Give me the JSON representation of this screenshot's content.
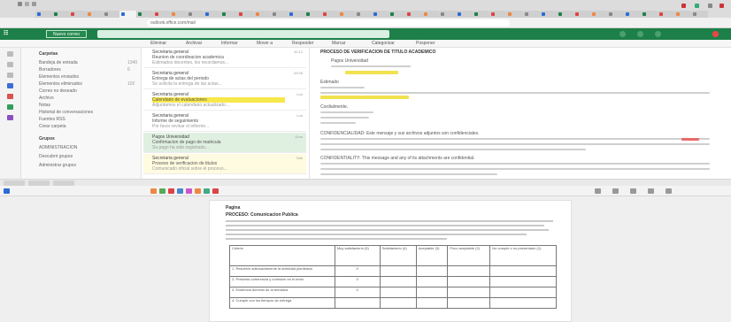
{
  "browser": {
    "url": "outlook.office.com/mail",
    "tabs": [
      "",
      "",
      "",
      "",
      "",
      "",
      "",
      "",
      "",
      "",
      "",
      "",
      "",
      "",
      "",
      "",
      "",
      "",
      "",
      "",
      "",
      "",
      "",
      "",
      "",
      "",
      "",
      "",
      "",
      "",
      "",
      "",
      "",
      "",
      "",
      "",
      "",
      "",
      "",
      ""
    ]
  },
  "app": {
    "new_mail": "Nuevo correo",
    "search_placeholder": "Buscar"
  },
  "ribbon": [
    "Eliminar",
    "Archivar",
    "Informar",
    "Mover a",
    "Responder",
    "Marcar",
    "Categorizar",
    "Posponer"
  ],
  "folders": {
    "header": "Carpetas",
    "items": [
      {
        "label": "Bandeja de entrada",
        "count": "1340"
      },
      {
        "label": "Borradores",
        "count": "6"
      },
      {
        "label": "Elementos enviados",
        "count": ""
      },
      {
        "label": "Elementos eliminados",
        "count": "102"
      },
      {
        "label": "Correo no deseado",
        "count": ""
      },
      {
        "label": "Archivo",
        "count": ""
      },
      {
        "label": "Notas",
        "count": ""
      },
      {
        "label": "Historial de conversaciones",
        "count": ""
      },
      {
        "label": "Fuentes RSS",
        "count": ""
      },
      {
        "label": "Crear carpeta",
        "count": ""
      },
      {
        "label": "Grupos",
        "count": ""
      },
      {
        "label": "ADMINISTRACION",
        "count": ""
      },
      {
        "label": "Descubrir grupos",
        "count": ""
      },
      {
        "label": "Administrar grupos",
        "count": ""
      }
    ]
  },
  "messages": [
    {
      "sender": "Secretaria general",
      "subject": "Reunion de coordinacion academica",
      "preview": "Estimados docentes, les recordamos...",
      "time": "10:12"
    },
    {
      "sender": "Secretaria general",
      "subject": "Entrega de actas del periodo",
      "preview": "Se solicita la entrega de las actas...",
      "time": "09:48"
    },
    {
      "sender": "Secretaria general",
      "subject": "Calendario de evaluaciones",
      "preview": "Adjuntamos el calendario actualizado...",
      "time": "Lun"
    },
    {
      "sender": "Secretaria general",
      "subject": "Informe de seguimiento",
      "preview": "Por favor revisar el informe...",
      "time": "Lun"
    },
    {
      "sender": "Pagos Universidad",
      "subject": "Confirmacion de pago de matricula",
      "preview": "Su pago ha sido registrado...",
      "time": "Dom"
    },
    {
      "sender": "Secretaria general",
      "subject": "Proceso de verificacion de titulos",
      "preview": "Comunicado oficial sobre el proceso...",
      "time": "Sab"
    }
  ],
  "reading": {
    "subject": "PROCESO DE VERIFICACION DE TITULO ACADEMICO",
    "from": "Pagos Universidad",
    "lines": [
      "Estimado",
      "Buenos dias.",
      "Cordialmente,",
      "CONFIDENCIALIDAD: Este mensaje y sus archivos adjuntos son confidenciales.",
      "CONFIDENTIALITY: This message and any of its attachments are confidential."
    ]
  },
  "doc": {
    "title": "Pagina",
    "subtitle": "PROCESO: Comunicacion Publica",
    "table": {
      "headers": [
        "Criterio",
        "Muy satisfactorio (5)",
        "Satisfactorio (4)",
        "Aceptable (3)",
        "Poco aceptable (2)",
        "No cumple o no presentado (1)"
      ],
      "rows": [
        [
          "1. Resuelve adecuadamente la actividad planteada",
          "X",
          "",
          "",
          "",
          ""
        ],
        [
          "2. Presenta coherencia y cohesion en el texto",
          "X",
          "",
          "",
          "",
          ""
        ],
        [
          "3. Evidencia dominio de la tematica",
          "X",
          "",
          "",
          "",
          ""
        ],
        [
          "4. Cumple con los tiempos de entrega",
          "",
          "",
          "",
          "",
          ""
        ]
      ]
    }
  }
}
